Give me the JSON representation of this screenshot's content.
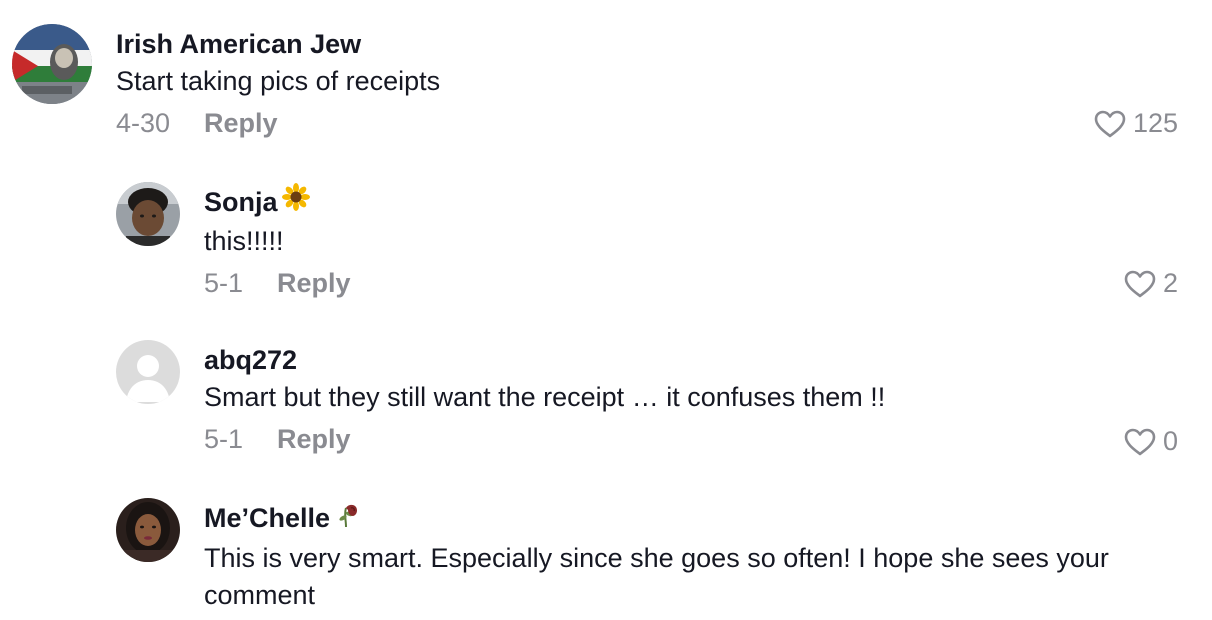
{
  "comments": [
    {
      "name": "Irish American Jew",
      "emoji": "",
      "text": "Start taking pics of receipts",
      "date": "4-30",
      "reply_label": "Reply",
      "likes": "125",
      "avatar": "avatar-flag-mural"
    },
    {
      "name": "Sonja",
      "emoji": "🌻",
      "text": "this!!!!!",
      "date": "5-1",
      "reply_label": "Reply",
      "likes": "2",
      "avatar": "avatar-person-photo"
    },
    {
      "name": "abq272",
      "emoji": "",
      "text": "Smart but they still want the receipt … it confuses them !!",
      "date": "5-1",
      "reply_label": "Reply",
      "likes": "0",
      "avatar": "default-user-icon"
    },
    {
      "name": "Me’Chelle",
      "emoji": "🥀",
      "text": "This is very smart. Especially since she goes so often! I hope she sees your comment",
      "date": "",
      "reply_label": "",
      "likes": "",
      "avatar": "avatar-person-photo"
    }
  ],
  "icons": {
    "like": "heart-outline-icon"
  },
  "colors": {
    "text": "#161823",
    "muted": "#8a8b91",
    "avatar_default_bg": "#dcdcdc"
  }
}
